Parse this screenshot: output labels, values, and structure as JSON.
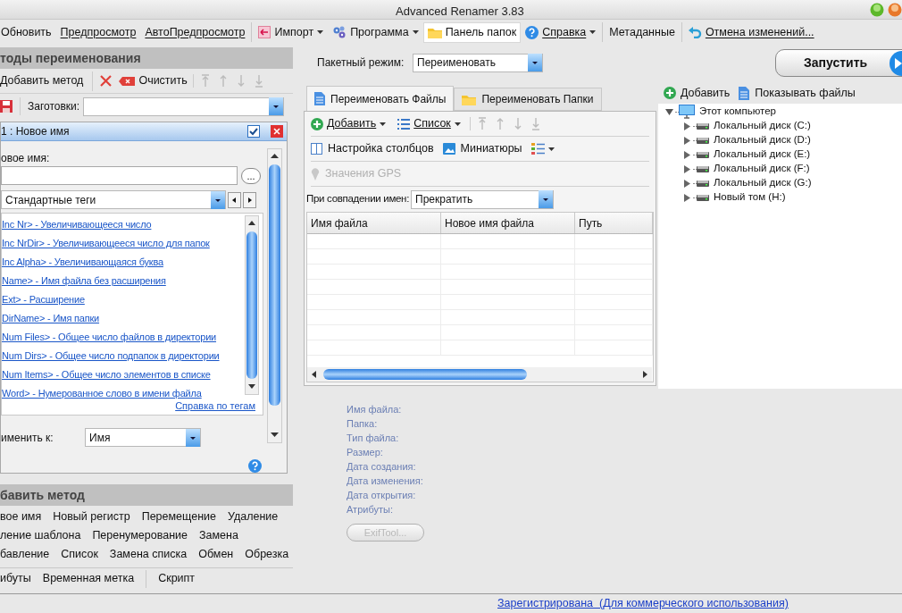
{
  "window": {
    "title": "Advanced Renamer 3.83"
  },
  "toolbar": [
    {
      "label": "Обновить",
      "menu": false,
      "selected": false
    },
    {
      "label": "Предпросмотр",
      "menu": false,
      "selected": false
    },
    {
      "label": "АвтоПредпросмотр",
      "menu": false,
      "selected": false
    },
    {
      "label": "Импорт",
      "menu": true,
      "selected": false
    },
    {
      "label": "Программа",
      "menu": true,
      "selected": false
    },
    {
      "label": "Панель папок",
      "menu": false,
      "selected": true
    },
    {
      "label": "Справка",
      "menu": true,
      "selected": false
    },
    {
      "label": "Метаданные",
      "menu": false,
      "selected": false
    },
    {
      "label": "Отмена изменений...",
      "menu": false,
      "selected": false
    }
  ],
  "methods_panel": {
    "title": "тоды переименования",
    "add_label": "Добавить метод",
    "clear_label": "Очистить",
    "presets_label": "Заготовки:",
    "method": {
      "title": "1 : Новое имя",
      "enabled": true,
      "new_name_label": "овое имя:",
      "browse": "...",
      "tag_group": "Стандартные теги",
      "tags": [
        "Inc Nr> - Увеличивающееся число",
        "Inc NrDir> - Увеличивающееся число для папок",
        "Inc Alpha> - Увеличивающаяся буква",
        "Name> - Имя файла без расширения",
        "Ext> - Расширение",
        "DirName> - Имя папки",
        "Num Files> - Общее число файлов в директории",
        "Num Dirs> - Общее число подпапок в директории",
        "Num Items> - Общее число элементов в списке",
        "Word> - Нумерованное слово в имени файла"
      ],
      "tags_help": "Справка по тегам",
      "apply_label": "именить к:",
      "apply_value": "Имя"
    }
  },
  "add_method": {
    "title": "бавить метод",
    "rows": [
      [
        "вое имя",
        "Новый регистр",
        "Перемещение",
        "Удаление"
      ],
      [
        "ление шаблона",
        "Перенумерование",
        "Замена"
      ],
      [
        "бавление",
        "Список",
        "Замена списка",
        "Обмен",
        "Обрезка"
      ],
      [
        "ибуты",
        "Временная метка",
        "Скрипт"
      ]
    ]
  },
  "batch": {
    "label": "Пакетный режим:",
    "value": "Переименовать"
  },
  "tabs": [
    {
      "label": "Переименовать Файлы",
      "selected": true
    },
    {
      "label": "Переименовать Папки",
      "selected": false
    }
  ],
  "files": {
    "add": "Добавить",
    "list": "Список",
    "columns": "Настройка столбцов",
    "thumbnails": "Миниатюры",
    "gps": {
      "label": "Значения GPS",
      "disabled": true
    },
    "conflict_label": "При совпадении имен:",
    "conflict_value": "Прекратить",
    "table": {
      "columns": [
        "Имя файла",
        "Новое имя файла",
        "Путь"
      ]
    }
  },
  "info": {
    "labels": [
      "Имя файла:",
      "Папка:",
      "Тип файла:",
      "Размер:",
      "Дата создания:",
      "Дата изменения:",
      "Дата открытия:",
      "Атрибуты:"
    ],
    "exiftool": {
      "label": "ExifTool...",
      "disabled": true
    }
  },
  "run_button": "Запустить",
  "folders": {
    "add": "Добавить",
    "show_files": "Показывать файлы",
    "tree": {
      "label": "Этот компьютер",
      "expanded": true,
      "children": [
        {
          "label": "Локальный диск (C:)",
          "expanded": false
        },
        {
          "label": "Локальный диск (D:)",
          "expanded": false
        },
        {
          "label": "Локальный диск (E:)",
          "expanded": false
        },
        {
          "label": "Локальный диск (F:)",
          "expanded": false
        },
        {
          "label": "Локальный диск (G:)",
          "expanded": false
        },
        {
          "label": "Новый том (H:)",
          "expanded": false
        }
      ]
    }
  },
  "status_bar": {
    "link": "Зарегистрирована  (Для коммерческого использования)"
  }
}
